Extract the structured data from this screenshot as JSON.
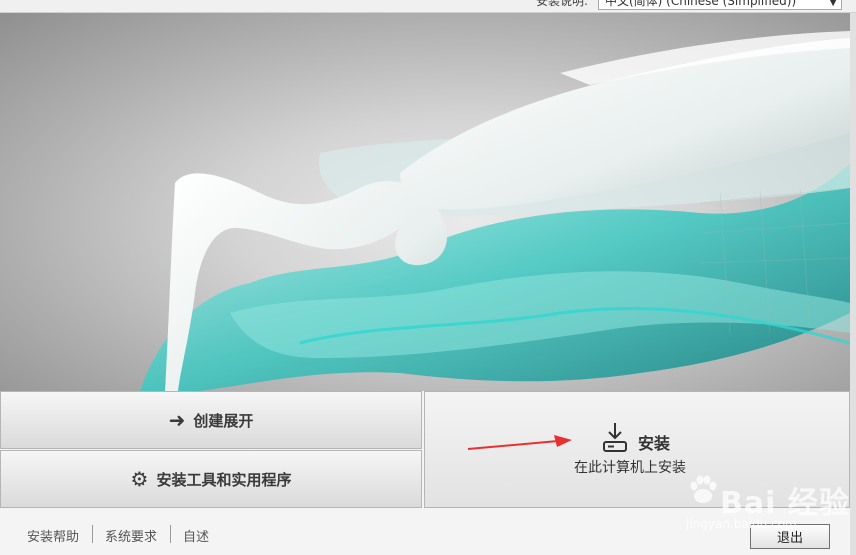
{
  "language": {
    "label": "安装说明:",
    "selected": "中文(简体) (Chinese (Simplified))"
  },
  "actions": {
    "deploy": {
      "label": "创建展开",
      "icon": "arrow-right-icon"
    },
    "tools": {
      "label": "安装工具和实用程序",
      "icon": "gear-icon"
    },
    "install": {
      "title": "安装",
      "subtitle": "在此计算机上安装",
      "icon": "download-icon"
    }
  },
  "footer": {
    "links": [
      "安装帮助",
      "系统要求",
      "自述"
    ],
    "exit_label": "退出"
  },
  "watermark": {
    "text": "Bai 经验",
    "sub": "jingyan.baidu.com"
  },
  "colors": {
    "accent_teal": "#3ec7c0",
    "annotation_red": "#e8312f"
  }
}
